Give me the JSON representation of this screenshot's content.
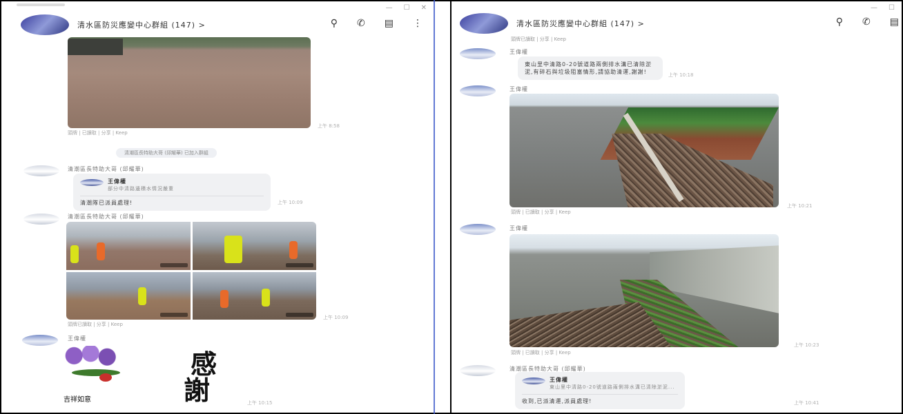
{
  "left": {
    "title": "清水區防災應變中心群組 (147) >",
    "header_icons": [
      "search-icon",
      "phone-icon",
      "notebook-icon",
      "more-icon"
    ],
    "msg1": {
      "meta": "頭牌 | 已讀取 | 分享 | Keep",
      "time": "上午 8:58"
    },
    "system": "清潮區長特助大哥 (邱耀華) 已加入群組",
    "msg2": {
      "sender": "清潮區長特助大哥 (邱耀華)",
      "quote_name": "王偉權",
      "quote_text": "部分中清路邊積水情況嚴重",
      "text": "清潮隊已派員處理!",
      "time": "上午 10:09"
    },
    "msg3": {
      "sender": "清潮區長特助大哥 (邱耀華)",
      "meta": "頭牌已讀取 | 分享 | Keep",
      "time": "上午 10:09"
    },
    "msg4": {
      "sender": "王偉權",
      "big1": "感",
      "big2": "謝",
      "small": "吉祥如意",
      "time": "上午 10:15"
    }
  },
  "right": {
    "title": "清水區防災應變中心群組 (147) >",
    "subheader": "頭牌已讀取 | 分享 | Keep",
    "header_icons": [
      "search-icon",
      "phone-icon",
      "notebook-icon"
    ],
    "msg1": {
      "sender": "王偉權",
      "text": "東山里中清路0-20號道路兩側排水溝已清除淤泥,有碎石與垃圾阻塞情形,請協助清運,謝謝!",
      "time": "上午 10:18"
    },
    "msg2": {
      "sender": "王偉權",
      "meta": "頭牌 | 已讀取 | 分享 | Keep",
      "time": "上午 10:21"
    },
    "msg3": {
      "sender": "王偉權",
      "meta": "頭牌 | 已讀取 | 分享 | Keep",
      "time": "上午 10:23"
    },
    "msg4": {
      "sender": "清潮區長特助大哥 (邱耀華)",
      "quote_name": "王偉權",
      "quote_text": "東山里中清路0-20號道路兩側排水溝已清除淤泥...",
      "text": "收到,已派清運,派員處理!",
      "time": "上午 10:41"
    }
  },
  "window_controls": [
    "minimize",
    "maximize",
    "close"
  ]
}
